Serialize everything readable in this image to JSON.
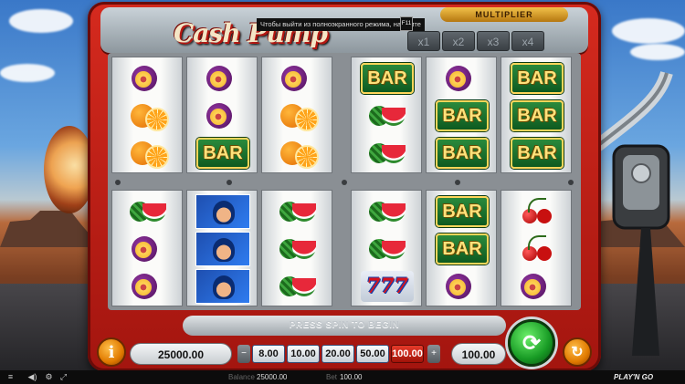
{
  "game": {
    "title": "Cash Pump",
    "tooltip": "Чтобы выйти из полноэкранного режима, нажмите",
    "tooltip_key": "F11"
  },
  "multiplier": {
    "title": "MULTIPLIER",
    "options": [
      "x1",
      "x2",
      "x3",
      "x4"
    ]
  },
  "reels": {
    "top_left": [
      [
        "plum",
        "orange",
        "orange"
      ],
      [
        "plum",
        "plum",
        "bar"
      ],
      [
        "plum",
        "orange",
        "orange"
      ]
    ],
    "top_right": [
      [
        "bar",
        "melon",
        "melon"
      ],
      [
        "plum",
        "bar",
        "bar"
      ],
      [
        "bar",
        "bar",
        "bar"
      ]
    ],
    "bottom_left": [
      [
        "melon",
        "plum",
        "plum"
      ],
      [
        "hero",
        "hero",
        "hero"
      ],
      [
        "melon",
        "melon",
        "melon"
      ]
    ],
    "bottom_right": [
      [
        "melon",
        "melon",
        "seven"
      ],
      [
        "bar",
        "bar",
        "plum"
      ],
      [
        "cherry",
        "cherry",
        "plum"
      ]
    ],
    "bar_text": "BAR",
    "seven_text": "777"
  },
  "message": "PRESS SPIN TO BEGIN",
  "controls": {
    "info_label": "i",
    "balance": "25000.00",
    "bet_steps": [
      "8.00",
      "10.00",
      "20.00",
      "50.00",
      "100.00"
    ],
    "active_step": "100.00",
    "minus": "−",
    "plus": "+",
    "bet": "100.00"
  },
  "status": {
    "balance_label": "Balance",
    "balance_value": "25000.00",
    "bet_label": "Bet",
    "bet_value": "100.00",
    "brand": "PLAY'N GO"
  },
  "colors": {
    "machine_red": "#c41f16",
    "spin_green": "#179a24",
    "active_chip": "#d0281a"
  }
}
